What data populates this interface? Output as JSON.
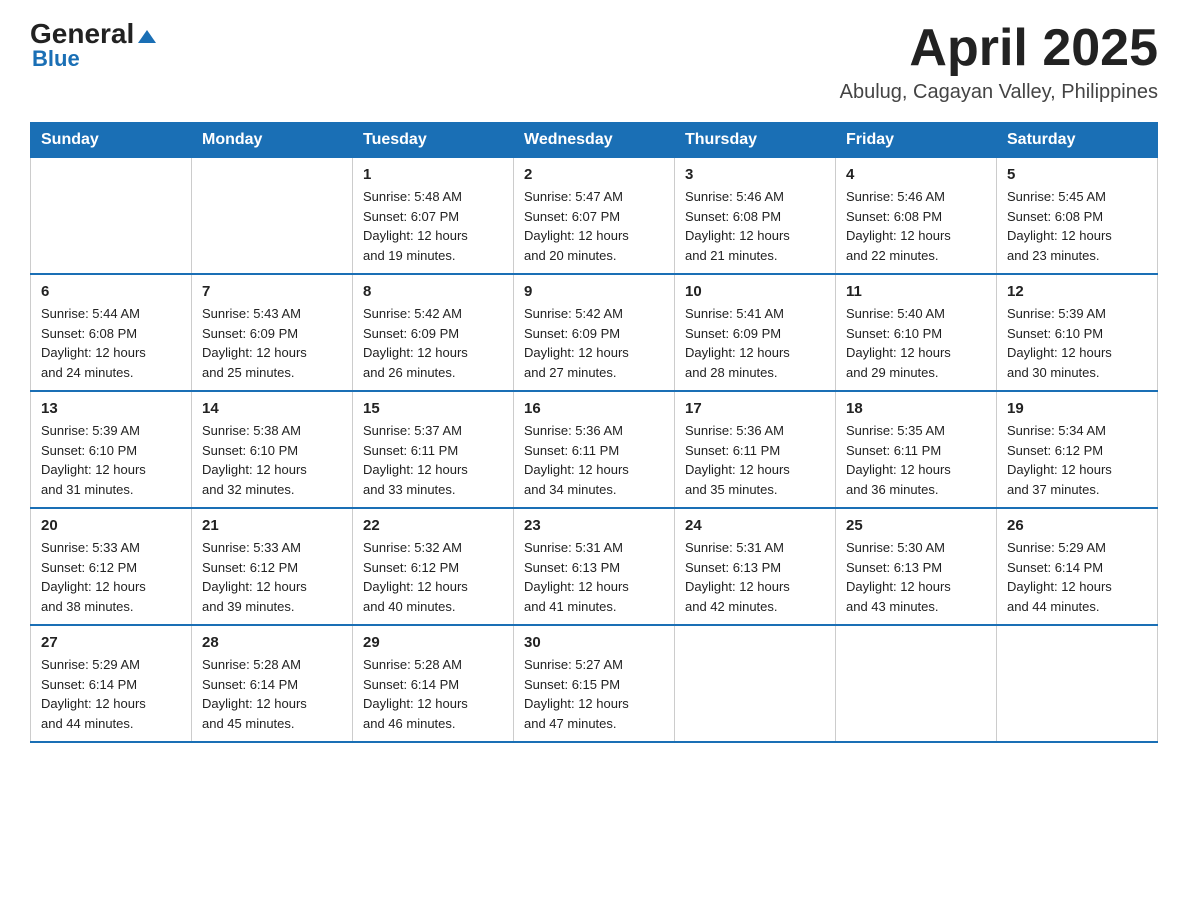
{
  "header": {
    "logo_top": "General",
    "logo_arrow": "▲",
    "logo_bottom": "Blue",
    "month_title": "April 2025",
    "location": "Abulug, Cagayan Valley, Philippines"
  },
  "weekdays": [
    "Sunday",
    "Monday",
    "Tuesday",
    "Wednesday",
    "Thursday",
    "Friday",
    "Saturday"
  ],
  "weeks": [
    [
      {
        "day": "",
        "info": ""
      },
      {
        "day": "",
        "info": ""
      },
      {
        "day": "1",
        "info": "Sunrise: 5:48 AM\nSunset: 6:07 PM\nDaylight: 12 hours\nand 19 minutes."
      },
      {
        "day": "2",
        "info": "Sunrise: 5:47 AM\nSunset: 6:07 PM\nDaylight: 12 hours\nand 20 minutes."
      },
      {
        "day": "3",
        "info": "Sunrise: 5:46 AM\nSunset: 6:08 PM\nDaylight: 12 hours\nand 21 minutes."
      },
      {
        "day": "4",
        "info": "Sunrise: 5:46 AM\nSunset: 6:08 PM\nDaylight: 12 hours\nand 22 minutes."
      },
      {
        "day": "5",
        "info": "Sunrise: 5:45 AM\nSunset: 6:08 PM\nDaylight: 12 hours\nand 23 minutes."
      }
    ],
    [
      {
        "day": "6",
        "info": "Sunrise: 5:44 AM\nSunset: 6:08 PM\nDaylight: 12 hours\nand 24 minutes."
      },
      {
        "day": "7",
        "info": "Sunrise: 5:43 AM\nSunset: 6:09 PM\nDaylight: 12 hours\nand 25 minutes."
      },
      {
        "day": "8",
        "info": "Sunrise: 5:42 AM\nSunset: 6:09 PM\nDaylight: 12 hours\nand 26 minutes."
      },
      {
        "day": "9",
        "info": "Sunrise: 5:42 AM\nSunset: 6:09 PM\nDaylight: 12 hours\nand 27 minutes."
      },
      {
        "day": "10",
        "info": "Sunrise: 5:41 AM\nSunset: 6:09 PM\nDaylight: 12 hours\nand 28 minutes."
      },
      {
        "day": "11",
        "info": "Sunrise: 5:40 AM\nSunset: 6:10 PM\nDaylight: 12 hours\nand 29 minutes."
      },
      {
        "day": "12",
        "info": "Sunrise: 5:39 AM\nSunset: 6:10 PM\nDaylight: 12 hours\nand 30 minutes."
      }
    ],
    [
      {
        "day": "13",
        "info": "Sunrise: 5:39 AM\nSunset: 6:10 PM\nDaylight: 12 hours\nand 31 minutes."
      },
      {
        "day": "14",
        "info": "Sunrise: 5:38 AM\nSunset: 6:10 PM\nDaylight: 12 hours\nand 32 minutes."
      },
      {
        "day": "15",
        "info": "Sunrise: 5:37 AM\nSunset: 6:11 PM\nDaylight: 12 hours\nand 33 minutes."
      },
      {
        "day": "16",
        "info": "Sunrise: 5:36 AM\nSunset: 6:11 PM\nDaylight: 12 hours\nand 34 minutes."
      },
      {
        "day": "17",
        "info": "Sunrise: 5:36 AM\nSunset: 6:11 PM\nDaylight: 12 hours\nand 35 minutes."
      },
      {
        "day": "18",
        "info": "Sunrise: 5:35 AM\nSunset: 6:11 PM\nDaylight: 12 hours\nand 36 minutes."
      },
      {
        "day": "19",
        "info": "Sunrise: 5:34 AM\nSunset: 6:12 PM\nDaylight: 12 hours\nand 37 minutes."
      }
    ],
    [
      {
        "day": "20",
        "info": "Sunrise: 5:33 AM\nSunset: 6:12 PM\nDaylight: 12 hours\nand 38 minutes."
      },
      {
        "day": "21",
        "info": "Sunrise: 5:33 AM\nSunset: 6:12 PM\nDaylight: 12 hours\nand 39 minutes."
      },
      {
        "day": "22",
        "info": "Sunrise: 5:32 AM\nSunset: 6:12 PM\nDaylight: 12 hours\nand 40 minutes."
      },
      {
        "day": "23",
        "info": "Sunrise: 5:31 AM\nSunset: 6:13 PM\nDaylight: 12 hours\nand 41 minutes."
      },
      {
        "day": "24",
        "info": "Sunrise: 5:31 AM\nSunset: 6:13 PM\nDaylight: 12 hours\nand 42 minutes."
      },
      {
        "day": "25",
        "info": "Sunrise: 5:30 AM\nSunset: 6:13 PM\nDaylight: 12 hours\nand 43 minutes."
      },
      {
        "day": "26",
        "info": "Sunrise: 5:29 AM\nSunset: 6:14 PM\nDaylight: 12 hours\nand 44 minutes."
      }
    ],
    [
      {
        "day": "27",
        "info": "Sunrise: 5:29 AM\nSunset: 6:14 PM\nDaylight: 12 hours\nand 44 minutes."
      },
      {
        "day": "28",
        "info": "Sunrise: 5:28 AM\nSunset: 6:14 PM\nDaylight: 12 hours\nand 45 minutes."
      },
      {
        "day": "29",
        "info": "Sunrise: 5:28 AM\nSunset: 6:14 PM\nDaylight: 12 hours\nand 46 minutes."
      },
      {
        "day": "30",
        "info": "Sunrise: 5:27 AM\nSunset: 6:15 PM\nDaylight: 12 hours\nand 47 minutes."
      },
      {
        "day": "",
        "info": ""
      },
      {
        "day": "",
        "info": ""
      },
      {
        "day": "",
        "info": ""
      }
    ]
  ]
}
